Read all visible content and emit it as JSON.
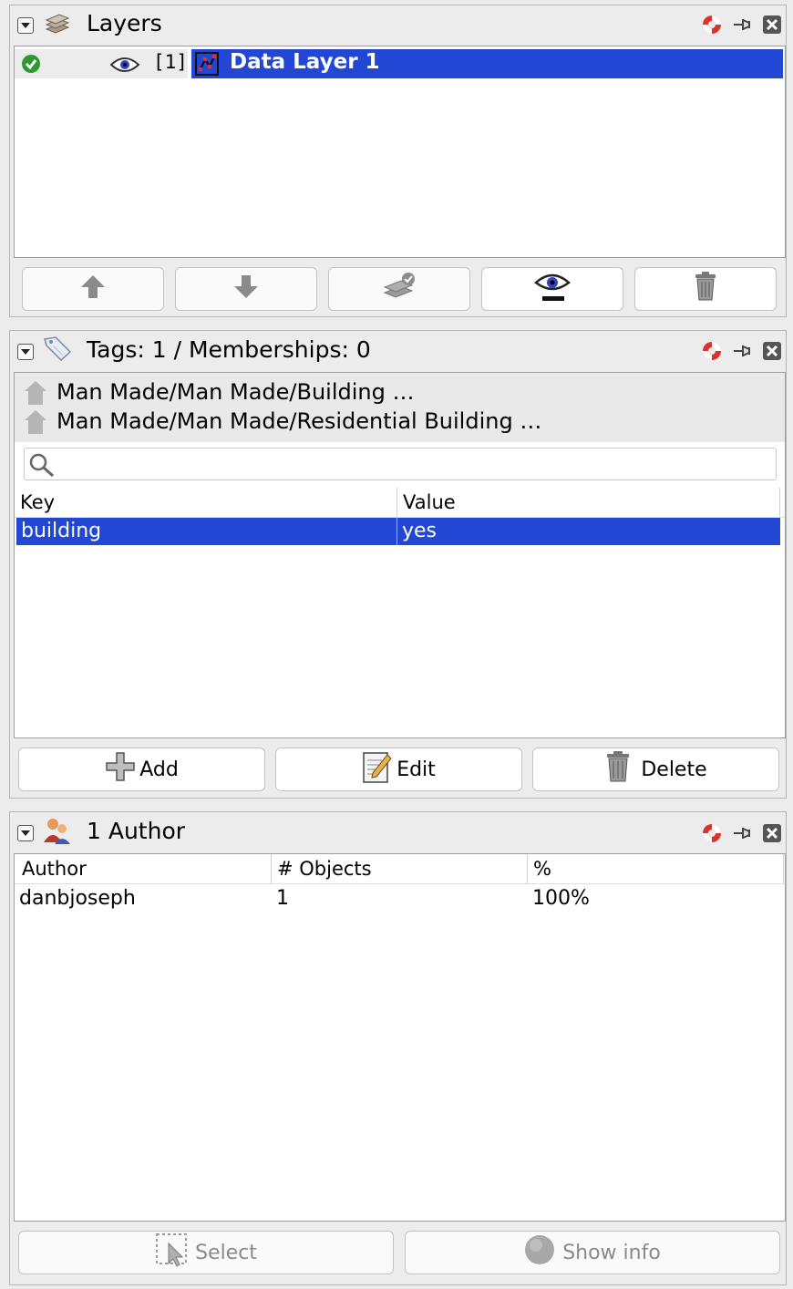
{
  "layers_panel": {
    "title": "Layers",
    "rows": [
      {
        "index": "[1]",
        "name": "Data Layer 1"
      }
    ]
  },
  "tags_panel": {
    "title": "Tags: 1 / Memberships: 0",
    "presets": [
      "Man Made/Man Made/Building …",
      "Man Made/Man Made/Residential Building …"
    ],
    "search_placeholder": "",
    "columns": [
      "Key",
      "Value"
    ],
    "rows": [
      {
        "key": "building",
        "value": "yes"
      }
    ],
    "buttons": {
      "add": "Add",
      "edit": "Edit",
      "delete": "Delete"
    }
  },
  "authors_panel": {
    "title": "1 Author",
    "columns": [
      "Author",
      "# Objects",
      "%"
    ],
    "rows": [
      {
        "author": "danbjoseph",
        "objects": "1",
        "percent": "100%"
      }
    ],
    "buttons": {
      "select": "Select",
      "show_info": "Show info"
    }
  },
  "colors": {
    "selection": "#2147d4",
    "panel_bg": "#ececec",
    "help_icon_red": "#d9332b",
    "valid_green": "#2e9a2e"
  },
  "icons": {
    "layers": "layers-stack-icon",
    "tags": "tag-icon",
    "authors": "users-icon",
    "help": "lifebuoy-icon",
    "detach": "pin-icon",
    "close": "close-icon"
  }
}
